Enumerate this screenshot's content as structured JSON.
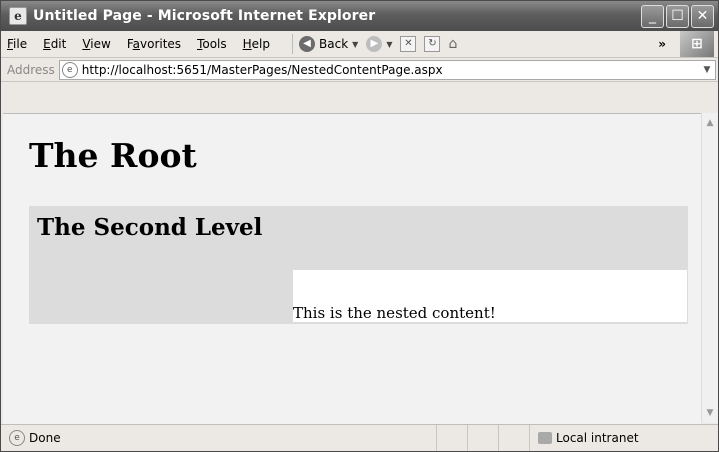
{
  "window": {
    "title": "Untitled Page - Microsoft Internet Explorer"
  },
  "menu": {
    "items": [
      {
        "first": "F",
        "rest": "ile"
      },
      {
        "first": "E",
        "rest": "dit"
      },
      {
        "first": "V",
        "rest": "iew"
      },
      {
        "first": "Fa",
        "rest": "vorites",
        "underline_index": 1
      },
      {
        "first": "T",
        "rest": "ools"
      },
      {
        "first": "H",
        "rest": "elp"
      }
    ]
  },
  "toolbar": {
    "back_label": "Back",
    "chevron": "»"
  },
  "address": {
    "label": "Address",
    "url": "http://localhost:5651/MasterPages/NestedContentPage.aspx"
  },
  "page": {
    "root_title": "The Root",
    "second_title": "The Second Level",
    "nested_text": "This is the nested content!"
  },
  "status": {
    "text": "Done",
    "zone": "Local intranet"
  },
  "icons": {
    "app": "ie-app-icon",
    "back": "back-arrow-icon",
    "forward": "forward-arrow-icon",
    "stop": "stop-icon",
    "refresh": "refresh-icon",
    "home": "home-icon",
    "page": "page-icon",
    "zone": "local-intranet-icon",
    "windows_logo": "windows-logo-icon"
  }
}
